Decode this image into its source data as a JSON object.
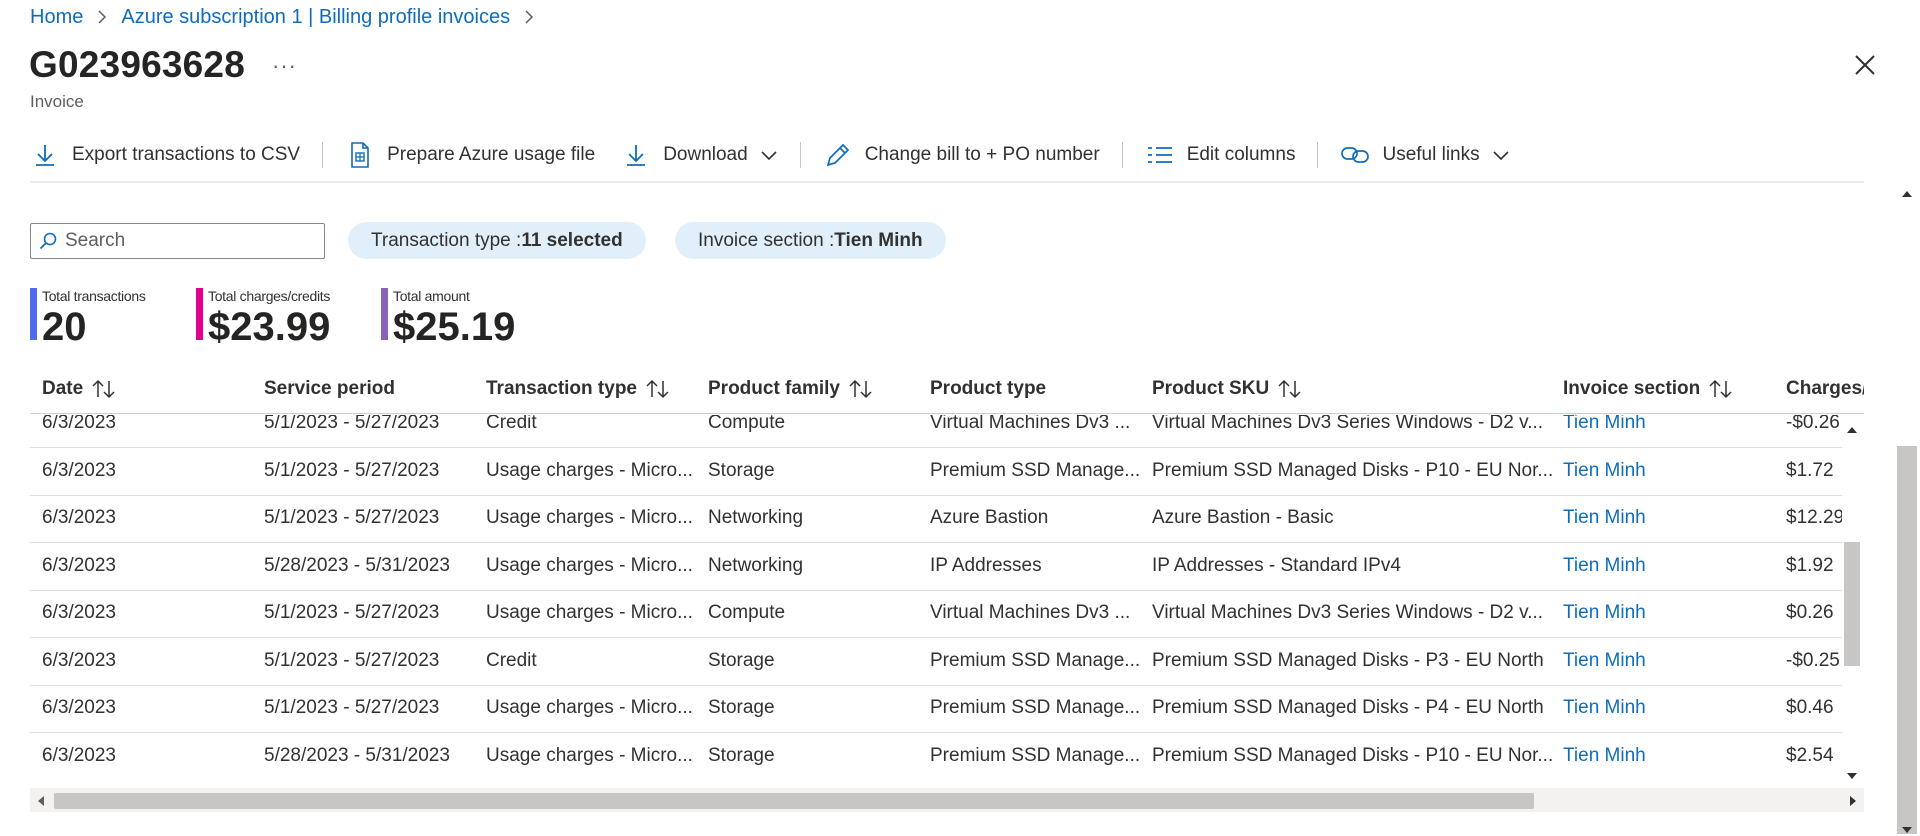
{
  "breadcrumb": {
    "home": "Home",
    "parent": "Azure subscription 1 | Billing profile invoices"
  },
  "header": {
    "title": "G023963628",
    "more": "···",
    "subtitle": "Invoice"
  },
  "toolbar": {
    "export_label": "Export transactions to CSV",
    "prepare_label": "Prepare Azure usage file",
    "download_label": "Download",
    "change_label": "Change bill to + PO number",
    "edit_columns_label": "Edit columns",
    "useful_links_label": "Useful links"
  },
  "filters": {
    "search_placeholder": "Search",
    "transaction_type_key": "Transaction type : ",
    "transaction_type_value": "11 selected",
    "invoice_section_key": "Invoice section : ",
    "invoice_section_value": "Tien Minh"
  },
  "summary": {
    "total_transactions_label": "Total transactions",
    "total_transactions_value": "20",
    "total_charges_label": "Total charges/credits",
    "total_charges_value": "$23.99",
    "total_amount_label": "Total amount",
    "total_amount_value": "$25.19",
    "colors": [
      "#4f6bed",
      "#e3008c",
      "#8764b8"
    ]
  },
  "table": {
    "columns": [
      "Date",
      "Service period",
      "Transaction type",
      "Product family",
      "Product type",
      "Product SKU",
      "Invoice section",
      "Charges/"
    ],
    "rows": [
      [
        "6/3/2023",
        "5/1/2023 - 5/27/2023",
        "Credit",
        "Compute",
        "Virtual Machines Dv3 ...",
        "Virtual Machines Dv3 Series Windows - D2 v...",
        "Tien Minh",
        "-$0.26"
      ],
      [
        "6/3/2023",
        "5/1/2023 - 5/27/2023",
        "Usage charges - Micro...",
        "Storage",
        "Premium SSD Manage...",
        "Premium SSD Managed Disks - P10 - EU Nor...",
        "Tien Minh",
        "$1.72"
      ],
      [
        "6/3/2023",
        "5/1/2023 - 5/27/2023",
        "Usage charges - Micro...",
        "Networking",
        "Azure Bastion",
        "Azure Bastion - Basic",
        "Tien Minh",
        "$12.29"
      ],
      [
        "6/3/2023",
        "5/28/2023 - 5/31/2023",
        "Usage charges - Micro...",
        "Networking",
        "IP Addresses",
        "IP Addresses - Standard IPv4",
        "Tien Minh",
        "$1.92"
      ],
      [
        "6/3/2023",
        "5/1/2023 - 5/27/2023",
        "Usage charges - Micro...",
        "Compute",
        "Virtual Machines Dv3 ...",
        "Virtual Machines Dv3 Series Windows - D2 v...",
        "Tien Minh",
        "$0.26"
      ],
      [
        "6/3/2023",
        "5/1/2023 - 5/27/2023",
        "Credit",
        "Storage",
        "Premium SSD Manage...",
        "Premium SSD Managed Disks - P3 - EU North",
        "Tien Minh",
        "-$0.25"
      ],
      [
        "6/3/2023",
        "5/1/2023 - 5/27/2023",
        "Usage charges - Micro...",
        "Storage",
        "Premium SSD Manage...",
        "Premium SSD Managed Disks - P4 - EU North",
        "Tien Minh",
        "$0.46"
      ],
      [
        "6/3/2023",
        "5/28/2023 - 5/31/2023",
        "Usage charges - Micro...",
        "Storage",
        "Premium SSD Manage...",
        "Premium SSD Managed Disks - P10 - EU Nor...",
        "Tien Minh",
        "$2.54"
      ]
    ]
  }
}
